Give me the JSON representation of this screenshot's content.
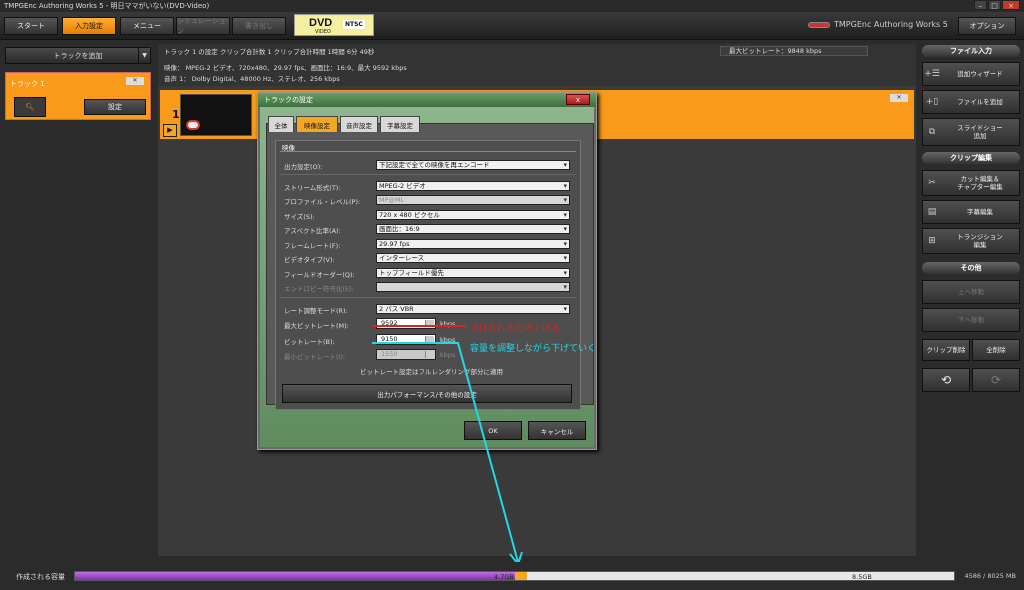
{
  "window": {
    "title": "TMPGEnc Authoring Works 5 - 明日ママがいない(DVD-Video)"
  },
  "toolbar": {
    "start": "スタート",
    "input_settings": "入力設定",
    "menu": "メニュー",
    "simulation": "シミュレーション",
    "write": "書き出し",
    "disc_type": "DVD",
    "disc_sub": "VIDEO",
    "standard": "NTSC",
    "brand": "TMPGEnc Authoring Works 5",
    "options": "オプション"
  },
  "left": {
    "add_track": "トラックを追加",
    "track_label": "トラック 1",
    "track_settings": "設定"
  },
  "info": {
    "header": "トラック 1 の設定   クリップ合計数  1     クリップ合計時間   1時間 6分 49秒",
    "video": "映像：    MPEG-2 ビデオ、720x480、29.97 fps、画面比：16:9、最大 9592 kbps",
    "audio": "音声 1：  Dolby Digital、48000 Hz、ステレオ、256 kbps",
    "max_bitrate": "最大ビットレート：9848 kbps"
  },
  "clip": {
    "number": "1"
  },
  "right": {
    "file_input": "ファイル入力",
    "add_wizard": "追加ウィザード",
    "add_file": "ファイルを追加",
    "slideshow_l1": "スライドショー",
    "slideshow_l2": "追加",
    "clip_edit": "クリップ編集",
    "cut_l1": "カット編集＆",
    "cut_l2": "チャプター編集",
    "subtitle_edit": "字幕編集",
    "transition_l1": "トランジション",
    "transition_l2": "編集",
    "other": "その他",
    "move_up": "上へ移動",
    "move_down": "下へ移動",
    "clip_delete": "クリップ削除",
    "delete_all": "全削除"
  },
  "dialog": {
    "title": "トラックの設定",
    "close": "x",
    "tabs": [
      "全体",
      "映像設定",
      "音声設定",
      "字幕設定"
    ],
    "group": "映像",
    "output_label": "出力設定(O):",
    "output_value": "下記設定で全ての映像を再エンコード",
    "stream_label": "ストリーム形式(T):",
    "stream_value": "MPEG-2 ビデオ",
    "profile_label": "プロファイル・レベル(P):",
    "profile_value": "MP@ML",
    "size_label": "サイズ(S):",
    "size_value": "720 x 480 ピクセル",
    "aspect_label": "アスペクト比率(A):",
    "aspect_value": "画面比：16:9",
    "framerate_label": "フレームレート(F):",
    "framerate_value": "29.97 fps",
    "videotype_label": "ビデオタイプ(V):",
    "videotype_value": "インターレース",
    "fieldorder_label": "フィールドオーダー(Q):",
    "fieldorder_value": "トップフィールド優先",
    "entropy_label": "エントロピー符号化(E):",
    "entropy_value": "",
    "ratemode_label": "レート調整モード(R):",
    "ratemode_value": "2 パス VBR",
    "maxbitrate_label": "最大ビットレート(M):",
    "maxbitrate_value": "9592",
    "bitrate_label": "ビットレート(B):",
    "bitrate_value": "9150",
    "minbitrate_label": "最小ビットレート(I):",
    "minbitrate_value": "1550",
    "unit": "kbps",
    "note": "ビットレート設定はフルレンダリング部分に適用",
    "perf_button": "出力パフォーマンス/その他の設定",
    "ok": "OK",
    "cancel": "キャンセル"
  },
  "annotations": {
    "red_text": "上げられるだけ上げる",
    "cyan_text": "容量を調整しながら下げていく",
    "red_color": "#dd2222",
    "cyan_color": "#22d8e6"
  },
  "capacity": {
    "label": "作成される容量",
    "used": "4.7GB",
    "total_mark": "8.5GB",
    "usage": "4586 / 8025 MB",
    "used_fraction": 0.5
  }
}
